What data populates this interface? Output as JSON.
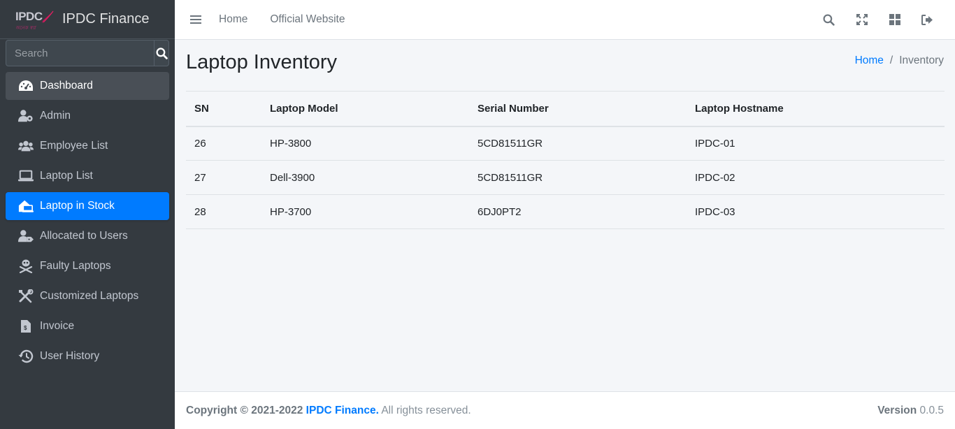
{
  "brand": {
    "logo_text": "IPDC",
    "logo_tagline": "অনেক স্বপ্ন",
    "title": "IPDC Finance"
  },
  "search": {
    "placeholder": "Search"
  },
  "sidebar": {
    "items": [
      {
        "label": "Dashboard",
        "icon": "dashboard-icon"
      },
      {
        "label": "Admin",
        "icon": "user-gear-icon"
      },
      {
        "label": "Employee List",
        "icon": "users-icon"
      },
      {
        "label": "Laptop List",
        "icon": "laptop-icon"
      },
      {
        "label": "Laptop in Stock",
        "icon": "warehouse-laptop-icon"
      },
      {
        "label": "Allocated to Users",
        "icon": "user-tag-icon"
      },
      {
        "label": "Faulty Laptops",
        "icon": "skull-crossbones-icon"
      },
      {
        "label": "Customized Laptops",
        "icon": "tools-icon"
      },
      {
        "label": "Invoice",
        "icon": "invoice-file-icon"
      },
      {
        "label": "User History",
        "icon": "history-icon"
      }
    ],
    "active_item": "Laptop in Stock"
  },
  "navbar": {
    "links": [
      "Home",
      "Official Website"
    ],
    "icons": [
      "search-icon",
      "fullscreen-icon",
      "grid-icon",
      "logout-icon"
    ]
  },
  "page": {
    "title": "Laptop Inventory",
    "breadcrumb": {
      "home": "Home",
      "separator": "/",
      "current": "Inventory"
    }
  },
  "table": {
    "headers": [
      "SN",
      "Laptop Model",
      "Serial Number",
      "Laptop Hostname"
    ],
    "rows": [
      [
        "26",
        "HP-3800",
        "5CD81511GR",
        "IPDC-01"
      ],
      [
        "27",
        "Dell-3900",
        "5CD81511GR",
        "IPDC-02"
      ],
      [
        "28",
        "HP-3700",
        "6DJ0PT2",
        "IPDC-03"
      ]
    ]
  },
  "footer": {
    "copyright": "Copyright © 2021-2022",
    "company": "IPDC Finance.",
    "rights": "All rights reserved.",
    "version_label": "Version",
    "version": "0.0.5"
  },
  "colors": {
    "sidebar_bg": "#343a40",
    "active": "#007bff",
    "link": "#007bff",
    "content_bg": "#f4f6f9"
  }
}
